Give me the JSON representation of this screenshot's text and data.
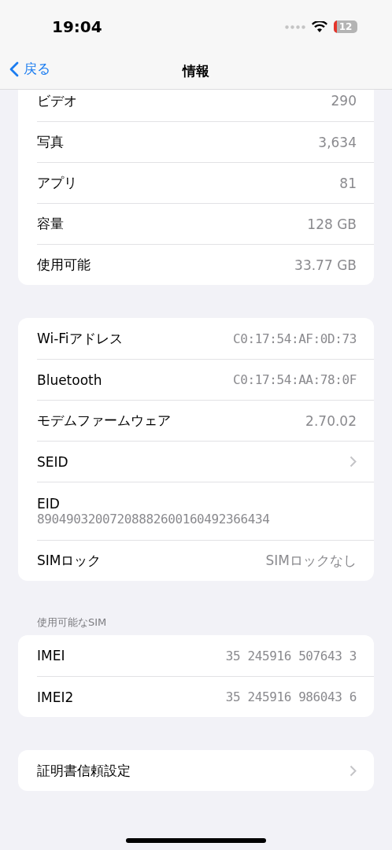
{
  "status_bar": {
    "time": "19:04",
    "battery": "12"
  },
  "nav": {
    "back": "戻る",
    "title": "情報"
  },
  "groups": [
    {
      "rows": [
        {
          "kind": "value",
          "label": "ビデオ",
          "value": "290"
        },
        {
          "kind": "value",
          "label": "写真",
          "value": "3,634"
        },
        {
          "kind": "value",
          "label": "アプリ",
          "value": "81"
        },
        {
          "kind": "value",
          "label": "容量",
          "value": "128 GB"
        },
        {
          "kind": "value",
          "label": "使用可能",
          "value": "33.77 GB"
        }
      ]
    },
    {
      "rows": [
        {
          "kind": "value",
          "label": "Wi-Fiアドレス",
          "value": "C0:17:54:AF:0D:73"
        },
        {
          "kind": "value",
          "label": "Bluetooth",
          "value": "C0:17:54:AA:78:0F"
        },
        {
          "kind": "value",
          "label": "モデムファームウェア",
          "value": "2.70.02"
        },
        {
          "kind": "link",
          "label": "SEID"
        },
        {
          "kind": "stacked",
          "label": "EID",
          "value": "89049032007208882600160492366434"
        },
        {
          "kind": "value",
          "label": "SIMロック",
          "value": "SIMロックなし"
        }
      ]
    },
    {
      "header": "使用可能なSIM",
      "rows": [
        {
          "kind": "value",
          "label": "IMEI",
          "value": "35 245916 507643 3"
        },
        {
          "kind": "value",
          "label": "IMEI2",
          "value": "35 245916 986043 6"
        }
      ]
    },
    {
      "rows": [
        {
          "kind": "link",
          "label": "証明書信頼設定"
        }
      ]
    }
  ]
}
